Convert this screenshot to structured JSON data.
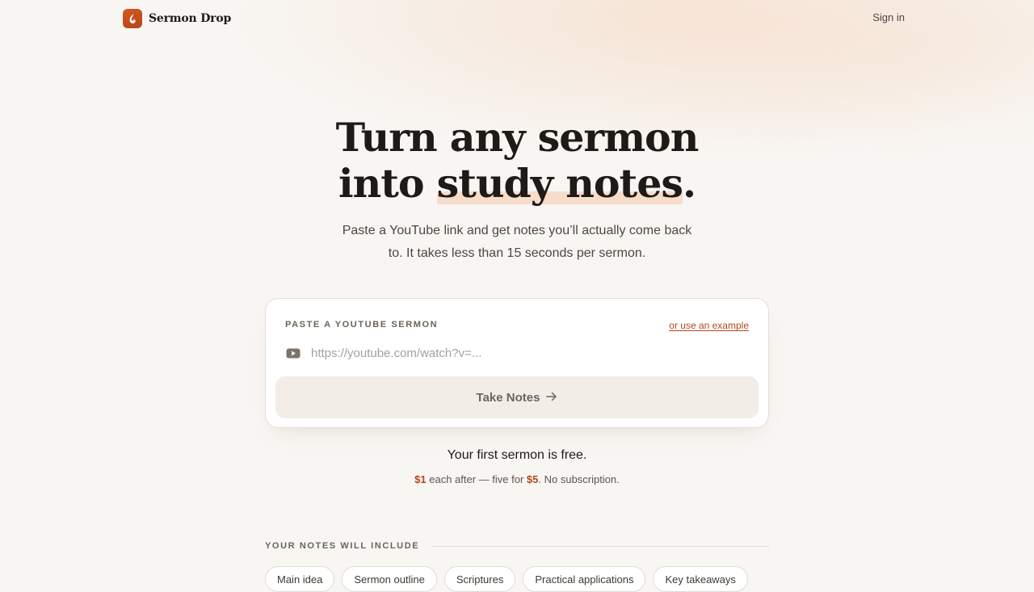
{
  "nav": {
    "brand_name": "Sermon Drop",
    "sign_in": "Sign in"
  },
  "hero": {
    "title_line1": "Turn any sermon",
    "title_line2_prefix": "into ",
    "title_highlight": "study notes",
    "title_suffix": ".",
    "subtitle": "Paste a YouTube link and get notes you’ll actually come back to. It takes less than 15 seconds per sermon."
  },
  "card": {
    "label": "PASTE A YOUTUBE SERMON",
    "example_link": "or use an example",
    "input_value": "",
    "input_placeholder": "https://youtube.com/watch?v=...",
    "button_label": "Take Notes",
    "button_icon": "arrow-right-icon",
    "input_icon": "youtube-icon"
  },
  "pricing": {
    "free_line": "Your first sermon is free.",
    "price_single": "$1",
    "text_each_after": " each after — five for ",
    "price_bundle": "$5",
    "text_no_sub": ". No subscription."
  },
  "includes": {
    "label": "YOUR NOTES WILL INCLUDE",
    "chips": [
      "Main idea",
      "Sermon outline",
      "Scriptures",
      "Practical applications",
      "Key takeaways"
    ]
  },
  "colors": {
    "accent": "#b4471c",
    "logo": "#c9501f",
    "background": "#f8f6f3",
    "highlight": "#f8dccb"
  }
}
